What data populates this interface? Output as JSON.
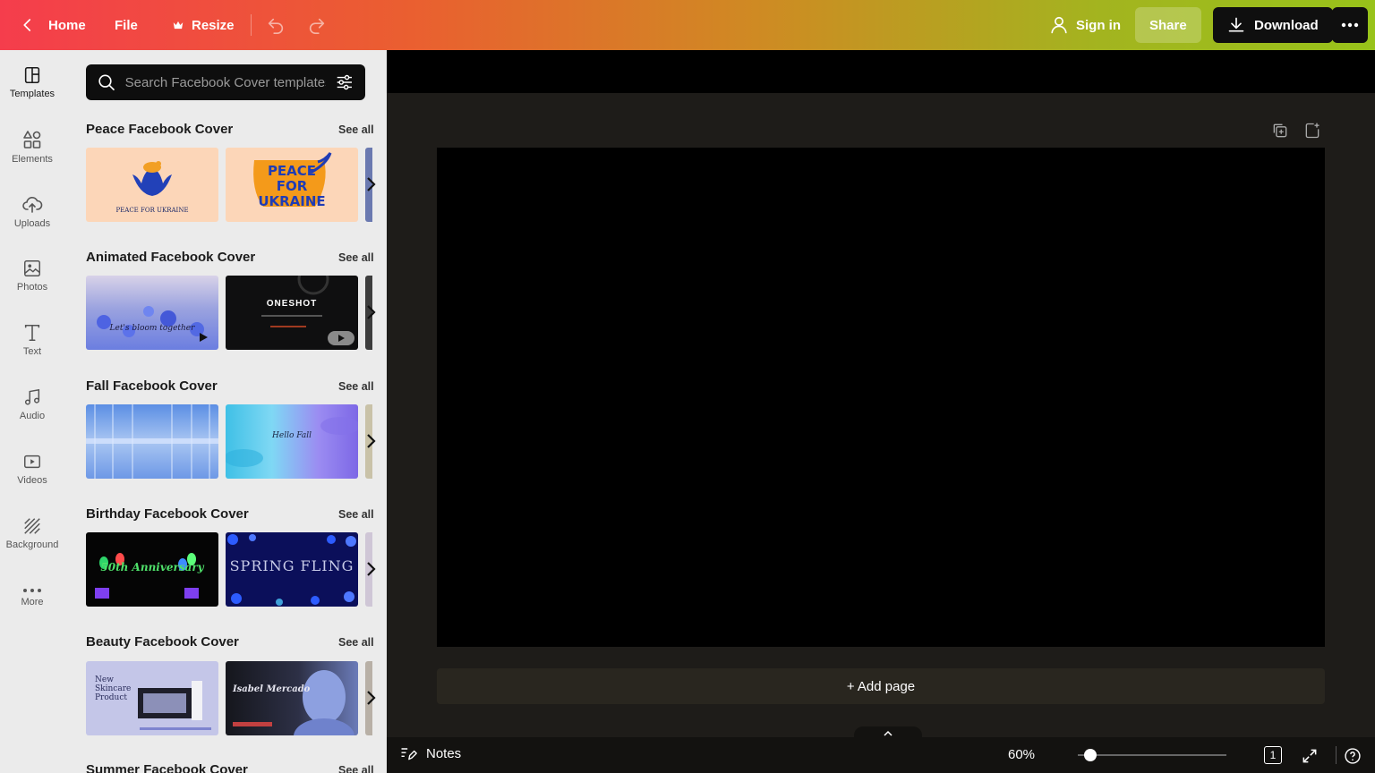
{
  "header": {
    "home_label": "Home",
    "file_label": "File",
    "resize_label": "Resize",
    "signin_label": "Sign in",
    "share_label": "Share",
    "download_label": "Download"
  },
  "rail": {
    "items": [
      {
        "label": "Templates",
        "icon": "templates-icon"
      },
      {
        "label": "Elements",
        "icon": "elements-icon"
      },
      {
        "label": "Uploads",
        "icon": "upload-cloud-icon"
      },
      {
        "label": "Photos",
        "icon": "image-icon"
      },
      {
        "label": "Text",
        "icon": "text-icon"
      },
      {
        "label": "Audio",
        "icon": "music-note-icon"
      },
      {
        "label": "Videos",
        "icon": "video-icon"
      },
      {
        "label": "Background",
        "icon": "background-pattern-icon"
      },
      {
        "label": "More",
        "icon": "more-dots-icon"
      }
    ]
  },
  "panel": {
    "search_placeholder": "Search Facebook Cover templates",
    "see_all": "See all",
    "sections": [
      {
        "title": "Peace Facebook Cover",
        "thumbs": [
          {
            "text": "PEACE FOR UKRAINE"
          },
          {
            "text": "PEACE FOR UKRAINE"
          }
        ]
      },
      {
        "title": "Animated Facebook Cover",
        "thumbs": [
          {
            "text": "Let's bloom together"
          },
          {
            "text": "ONESHOT"
          }
        ]
      },
      {
        "title": "Fall Facebook Cover",
        "thumbs": [
          {
            "text": ""
          },
          {
            "text": "Hello Fall"
          }
        ]
      },
      {
        "title": "Birthday Facebook Cover",
        "thumbs": [
          {
            "text": "50th Anniversary"
          },
          {
            "text": "SPRING FLING"
          }
        ]
      },
      {
        "title": "Beauty Facebook Cover",
        "thumbs": [
          {
            "text": "New Skincare Product"
          },
          {
            "text": "Isabel Mercado"
          }
        ]
      },
      {
        "title": "Summer Facebook Cover",
        "thumbs": []
      }
    ]
  },
  "canvas": {
    "add_page_label": "+ Add page"
  },
  "footer": {
    "notes_label": "Notes",
    "zoom_text": "60%",
    "zoom_level": 0.6,
    "page_count": "1"
  },
  "colors": {
    "header_gradient_start": "#f53d4c",
    "header_gradient_end": "#98c31a",
    "canvas_bg": "#000000",
    "workspace_bg": "#1e1c19"
  }
}
